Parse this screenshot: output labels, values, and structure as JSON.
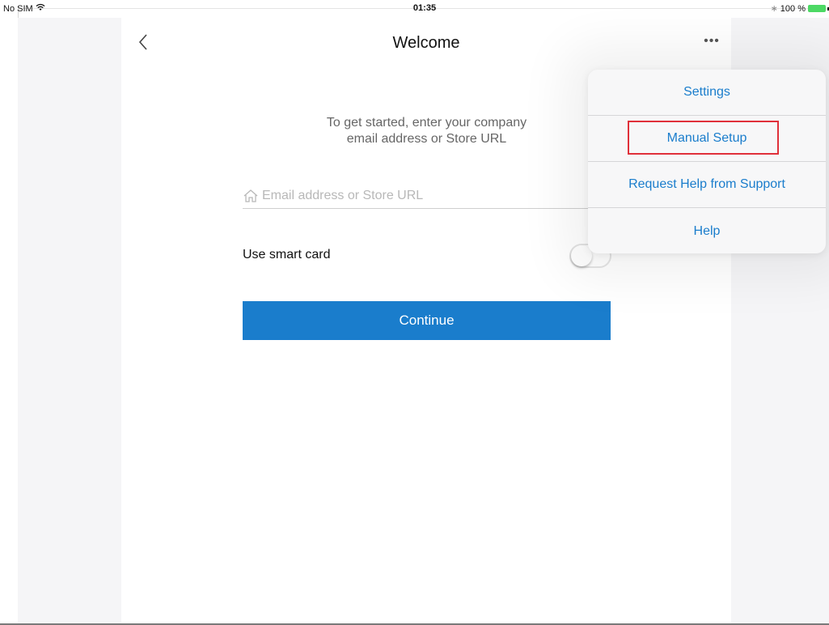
{
  "status_bar": {
    "carrier": "No SIM",
    "time": "01:35",
    "battery_text": "100 %"
  },
  "nav": {
    "title": "Welcome",
    "more_label": "•••"
  },
  "form": {
    "intro_line1": "To get started, enter your company",
    "intro_line2": "email address or Store URL",
    "email_placeholder": "Email address or Store URL",
    "email_value": "",
    "smart_card_label": "Use smart card",
    "smart_card_enabled": false,
    "continue_label": "Continue"
  },
  "menu": {
    "items": [
      {
        "label": "Settings"
      },
      {
        "label": "Manual Setup",
        "highlighted": true
      },
      {
        "label": "Request Help from Support"
      },
      {
        "label": "Help"
      }
    ]
  },
  "colors": {
    "accent": "#1a7dcc",
    "highlight_border": "#e0303a",
    "battery": "#4cd964"
  },
  "icons": {
    "back": "chevron-left-icon",
    "more": "ellipsis-icon",
    "email": "home-icon",
    "wifi": "wifi-icon",
    "bluetooth": "bluetooth-icon",
    "battery": "battery-icon"
  }
}
